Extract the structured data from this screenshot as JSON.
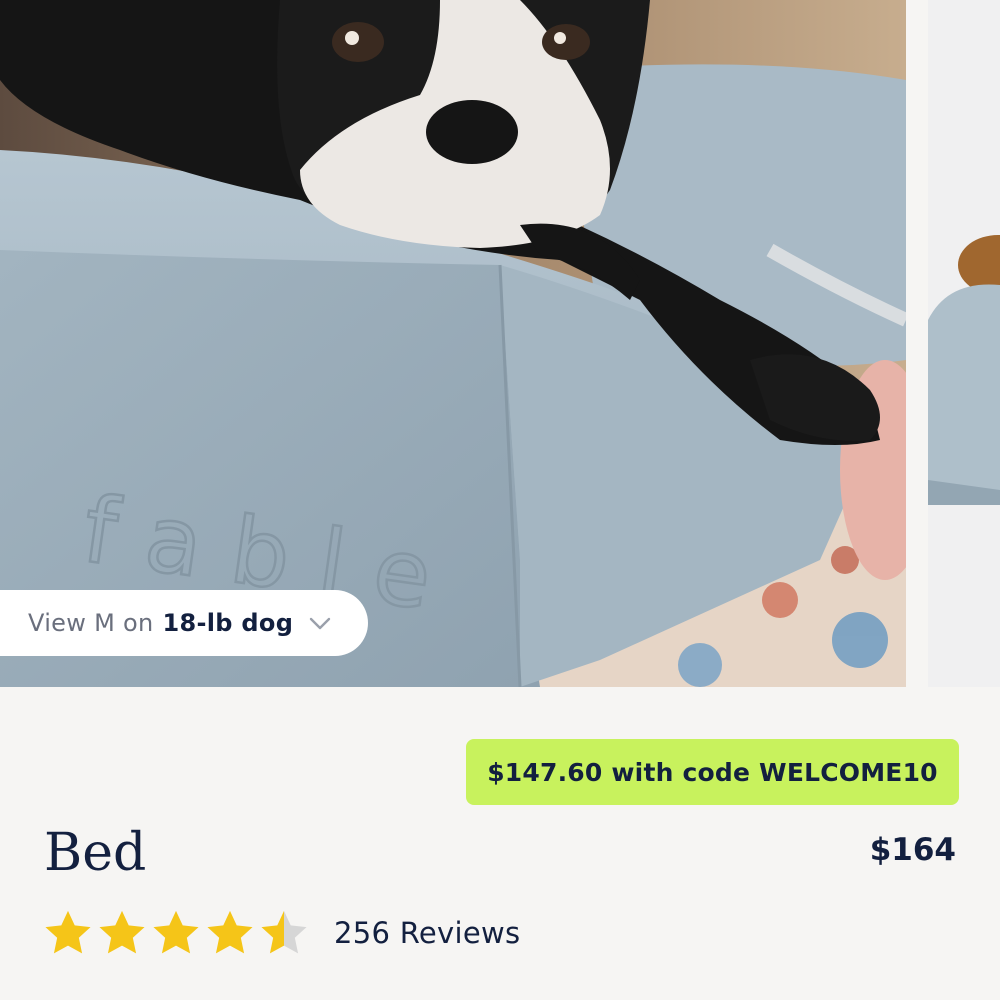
{
  "product": {
    "title": "Bed",
    "price": "$164",
    "promo": "$147.60 with code WELCOME10",
    "rating_value": 4.5,
    "rating_max": 5,
    "reviews_text": "256 Reviews"
  },
  "gallery": {
    "brand_mark": "fable",
    "size_selector": {
      "prefix": "View M on",
      "value": "18-lb dog",
      "icon": "chevron-down-icon"
    }
  },
  "colors": {
    "promo_bg": "#c8f25d",
    "star_fill": "#f5c518",
    "star_empty": "#d6d6d6",
    "text_primary": "#13203f"
  }
}
